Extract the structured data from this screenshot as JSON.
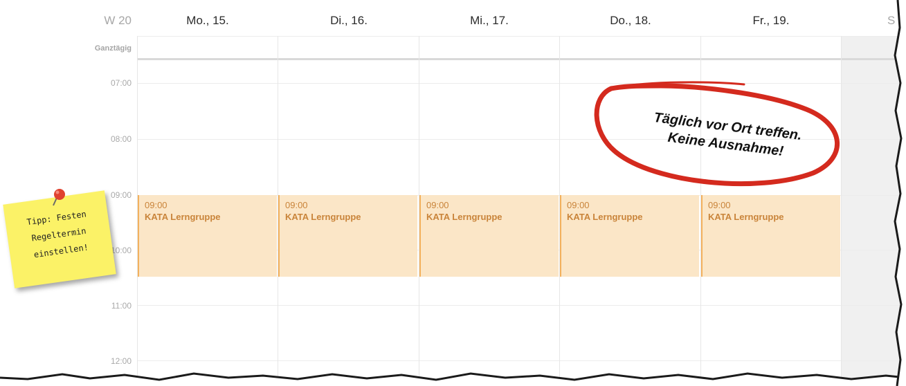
{
  "calendar": {
    "week_label": "W 20",
    "days": [
      {
        "label": "Mo., 15."
      },
      {
        "label": "Di., 16."
      },
      {
        "label": "Mi., 17."
      },
      {
        "label": "Do., 18."
      },
      {
        "label": "Fr., 19."
      },
      {
        "label": "S"
      }
    ],
    "allday_label": "Ganztägig",
    "hours": [
      "07:00",
      "08:00",
      "09:00",
      "10:00",
      "11:00",
      "12:00"
    ],
    "events": [
      {
        "time": "09:00",
        "title": "KATA Lerngruppe"
      },
      {
        "time": "09:00",
        "title": "KATA Lerngruppe"
      },
      {
        "time": "09:00",
        "title": "KATA Lerngruppe"
      },
      {
        "time": "09:00",
        "title": "KATA Lerngruppe"
      },
      {
        "time": "09:00",
        "title": "KATA Lerngruppe"
      }
    ],
    "event_colors": {
      "background": "#fbe6c7",
      "border": "#f3b15d",
      "text": "#c9843a"
    }
  },
  "sticky_note": {
    "text": "Tipp: Festen\nRegeltermin\neinstellen!",
    "color": "#fbf267",
    "pin_color": "#e0422f"
  },
  "callout": {
    "text": "Täglich vor Ort treffen.\nKeine Ausnahme!",
    "ring_color": "#d42a1e"
  }
}
